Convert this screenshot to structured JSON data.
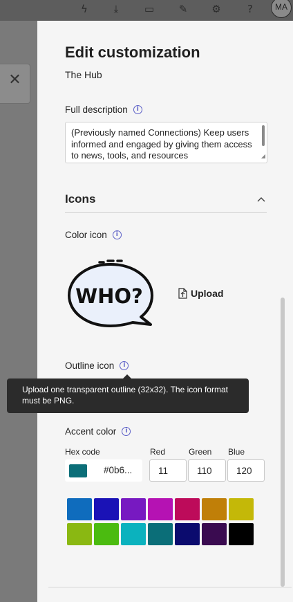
{
  "background": {
    "toolbar_icons": [
      "lightning-icon",
      "download-icon",
      "terminal-icon",
      "edit-page-icon",
      "gear-icon",
      "help-icon"
    ],
    "toolbar_glyphs": [
      "ϟ",
      "⤓",
      "▭",
      "✎",
      "⚙",
      "?"
    ],
    "avatar_initials": "MA",
    "close_glyph": "✕"
  },
  "panel": {
    "title": "Edit customization",
    "subtitle": "The Hub",
    "full_description": {
      "label": "Full description",
      "value": "(Previously named Connections) Keep users informed and engaged by giving them access to news, tools, and resources"
    },
    "icons_section": {
      "title": "Icons",
      "color_icon_label": "Color icon",
      "color_icon_text": "WHO?",
      "upload_label": "Upload",
      "outline_icon_label": "Outline icon",
      "tooltip": "Upload one transparent outline (32x32). The icon format must be PNG."
    },
    "accent": {
      "label": "Accent color",
      "hex_label": "Hex code",
      "hex_value": "#0b6...",
      "red_label": "Red",
      "red_value": "11",
      "green_label": "Green",
      "green_value": "110",
      "blue_label": "Blue",
      "blue_value": "120",
      "current_color": "#0b6e78",
      "palette": [
        "#0f6cbd",
        "#1a12b6",
        "#7719c1",
        "#b512b3",
        "#bd0b5a",
        "#c07f08",
        "#c4b808",
        "#8ab812",
        "#4bbb10",
        "#0bb2be",
        "#0b6e78",
        "#0b0b6e",
        "#3a0b50",
        "#000000"
      ]
    }
  }
}
